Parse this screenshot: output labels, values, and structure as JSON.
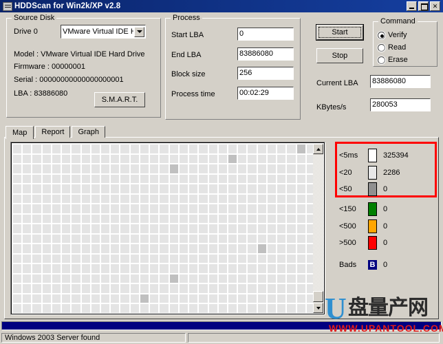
{
  "window": {
    "title": "HDDScan for Win2k/XP   v2.8",
    "icon": "app-window-icon",
    "controls": {
      "minimize": "_",
      "maximize": "□",
      "close": "✕"
    }
  },
  "source_disk": {
    "legend": "Source Disk",
    "drive_label": "Drive  0",
    "drive_combo_value": "VMware Virtual IDE H",
    "model": "Model : VMware Virtual IDE Hard Drive",
    "firmware": "Firmware : 00000001",
    "serial": "Serial : 00000000000000000001",
    "lba": "LBA :  83886080",
    "smart_button": "S.M.A.R.T."
  },
  "process": {
    "legend": "Process",
    "fields": [
      {
        "label": "Start LBA",
        "value": "0"
      },
      {
        "label": "End LBA",
        "value": "83886080"
      },
      {
        "label": "Block size",
        "value": "256"
      },
      {
        "label": "Process time",
        "value": "00:02:29"
      }
    ]
  },
  "controls": {
    "start_button": "Start",
    "stop_button": "Stop",
    "current_lba_label": "Current LBA",
    "current_lba_value": "83886080",
    "kbytes_label": "KBytes/s",
    "kbytes_value": "280053"
  },
  "command": {
    "legend": "Command",
    "options": [
      {
        "label": "Verify",
        "selected": true
      },
      {
        "label": "Read",
        "selected": false
      },
      {
        "label": "Erase",
        "selected": false
      }
    ]
  },
  "tabs": [
    {
      "label": "Map",
      "active": true
    },
    {
      "label": "Report",
      "active": false
    },
    {
      "label": "Graph",
      "active": false
    }
  ],
  "legend_panel": {
    "highlight_color": "#ff0000",
    "rows": [
      {
        "name": "<5ms",
        "count": "325394",
        "color": "#ffffff"
      },
      {
        "name": "<20",
        "count": "2286",
        "color": "#e8e8e8"
      },
      {
        "name": "<50",
        "count": "0",
        "color": "#909090"
      },
      {
        "name": "<150",
        "count": "0",
        "color": "#008000"
      },
      {
        "name": "<500",
        "count": "0",
        "color": "#ffa500"
      },
      {
        "name": ">500",
        "count": "0",
        "color": "#ff0000"
      }
    ],
    "bads_label": "Bads",
    "bads_badge": "B",
    "bads_count": "0"
  },
  "map": {
    "cell_color": "#e4e4e4",
    "marked_color": "#c0c0c0",
    "cols": 31,
    "rows": 17,
    "marked_cells": [
      [
        0,
        29
      ],
      [
        1,
        22
      ],
      [
        2,
        16
      ],
      [
        10,
        25
      ],
      [
        13,
        16
      ],
      [
        15,
        13
      ]
    ]
  },
  "progress": {
    "percent": 100,
    "color": "#000080"
  },
  "statusbar": {
    "message": "Windows 2003 Server found",
    "secondary": ""
  },
  "watermark": {
    "logo": "U",
    "chinese": "盘量产网",
    "url": "WWW.UPANTOOL.COM"
  }
}
